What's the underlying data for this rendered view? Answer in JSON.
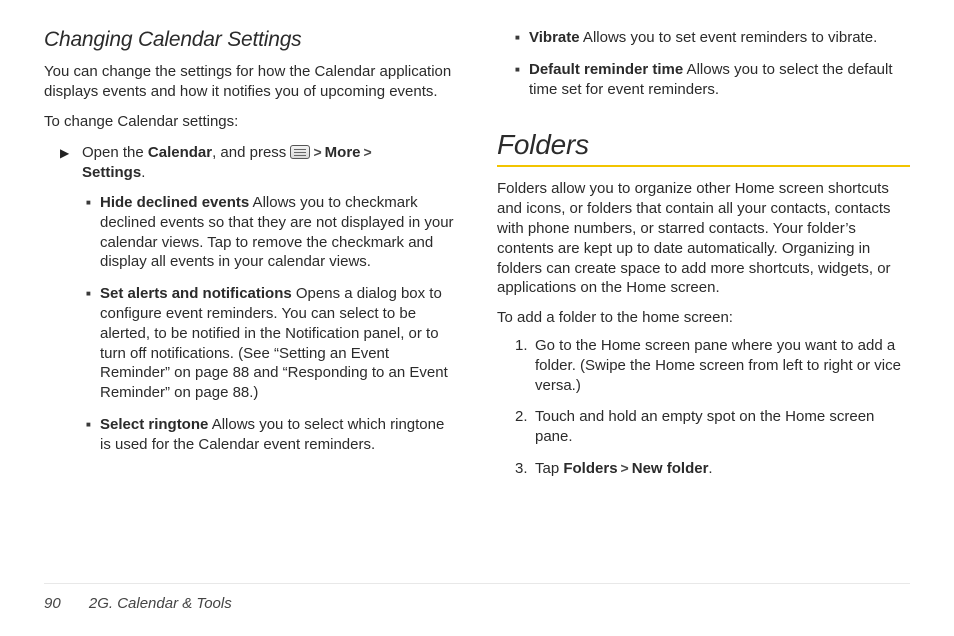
{
  "left": {
    "heading": "Changing Calendar Settings",
    "intro": "You can change the settings for how the Calendar application displays events and how it notifies you of upcoming events.",
    "lead": "To change Calendar settings:",
    "open_pre": "Open the ",
    "calendar": "Calendar",
    "open_mid": ", and press ",
    "more": "More",
    "settings": "Settings",
    "period": ".",
    "items": [
      {
        "title": "Hide declined events",
        "desc": " Allows you to checkmark declined events so that they are not displayed in your calendar views. Tap to remove the checkmark and display all events in your calendar views."
      },
      {
        "title": "Set alerts and notifications",
        "desc": " Opens a dialog box to configure event reminders. You can select to be alerted, to be notified in the Notification panel, or to turn off notifications. (See “Setting an Event Reminder” on page 88 and “Responding to an Event Reminder” on page 88.)"
      },
      {
        "title": "Select ringtone",
        "desc": " Allows you to select which ringtone is used for the Calendar event reminders."
      }
    ]
  },
  "right": {
    "top_items": [
      {
        "title": "Vibrate",
        "desc": " Allows you to set event reminders to vibrate."
      },
      {
        "title": "Default reminder time",
        "desc": " Allows you to select the default time set for event reminders."
      }
    ],
    "heading": "Folders",
    "intro": "Folders allow you to organize other Home screen shortcuts and icons, or folders that contain all your contacts, contacts with phone numbers, or starred contacts. Your folder’s contents are kept up to date automatically. Organizing in folders can create space to add more shortcuts, widgets, or applications on the Home screen.",
    "lead": "To add a folder to the home screen:",
    "steps": [
      {
        "n": "1.",
        "t": "Go to the Home screen pane where you want to add a folder. (Swipe the Home screen from left to right or vice versa.)"
      },
      {
        "n": "2.",
        "t": "Touch and hold an empty spot on the Home screen pane."
      }
    ],
    "step3_n": "3.",
    "step3_pre": "Tap ",
    "step3_a": "Folders",
    "step3_b": "New folder",
    "step3_post": "."
  },
  "footer": {
    "page": "90",
    "section": "2G. Calendar & Tools"
  }
}
